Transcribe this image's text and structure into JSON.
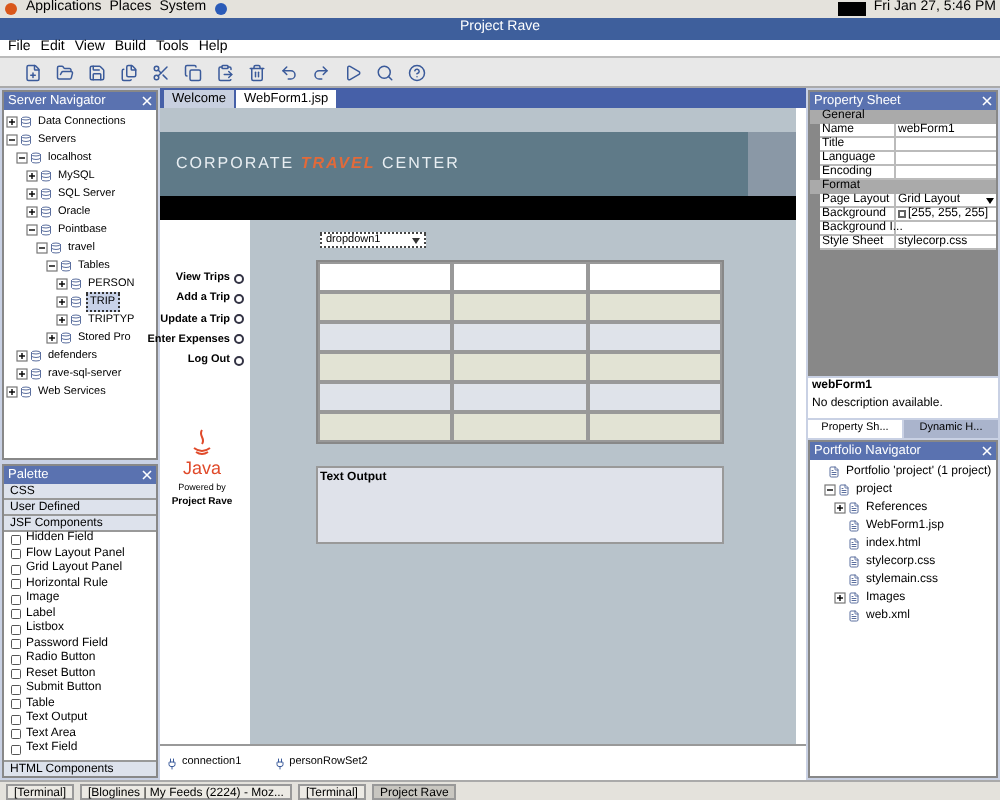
{
  "top_panel": {
    "menus": [
      "Applications",
      "Places",
      "System"
    ],
    "clock": "Fri Jan 27,  5:46 PM"
  },
  "window": {
    "title": "Project Rave"
  },
  "menu_bar": [
    "File",
    "Edit",
    "View",
    "Build",
    "Tools",
    "Help"
  ],
  "server_navigator": {
    "title": "Server Navigator",
    "tree": [
      {
        "label": "Data Connections",
        "expanded": false,
        "selected": false
      },
      {
        "label": "Servers",
        "expanded": true,
        "selected": false,
        "children": [
          {
            "label": "localhost",
            "expanded": true,
            "selected": false,
            "children": [
              {
                "label": "MySQL",
                "expanded": false,
                "selected": false
              },
              {
                "label": "SQL Server",
                "expanded": false,
                "selected": false
              },
              {
                "label": "Oracle",
                "expanded": false,
                "selected": false
              },
              {
                "label": "Pointbase",
                "expanded": true,
                "selected": false,
                "children": [
                  {
                    "label": "travel",
                    "expanded": true,
                    "selected": false,
                    "children": [
                      {
                        "label": "Tables",
                        "expanded": true,
                        "selected": false,
                        "children": [
                          {
                            "label": "PERSON",
                            "expanded": false,
                            "selected": false
                          },
                          {
                            "label": "TRIP",
                            "expanded": false,
                            "selected": true
                          },
                          {
                            "label": "TRIPTYP",
                            "expanded": false,
                            "selected": false
                          }
                        ]
                      },
                      {
                        "label": "Stored Pro",
                        "expanded": false,
                        "selected": false
                      }
                    ]
                  }
                ]
              }
            ]
          },
          {
            "label": "defenders",
            "expanded": false,
            "selected": false
          },
          {
            "label": "rave-sql-server",
            "expanded": false,
            "selected": false
          }
        ]
      },
      {
        "label": "Web Services",
        "expanded": false,
        "selected": false
      }
    ]
  },
  "palette": {
    "title": "Palette",
    "sections": [
      "CSS",
      "User Defined",
      "JSF Components"
    ],
    "items": [
      "Hidden Field",
      "Flow Layout Panel",
      "Grid Layout Panel",
      "Horizontal Rule",
      "Image",
      "Label",
      "Listbox",
      "Password Field",
      "Radio Button",
      "Reset Button",
      "Submit Button",
      "Table",
      "Text Output",
      "Text Area",
      "Text Field"
    ],
    "footer": "HTML Components"
  },
  "editor_tabs": [
    {
      "label": "Welcome",
      "selected": false
    },
    {
      "label": "WebForm1.jsp",
      "selected": true
    }
  ],
  "page": {
    "banner": {
      "left": "CORPORATE",
      "accent": "TRAVEL",
      "right": "CENTER"
    },
    "nav_links": [
      "View Trips",
      "Add a Trip",
      "Update a Trip",
      "Enter Expenses",
      "Log Out"
    ],
    "logo_text": "Java",
    "powered_by": "Powered by",
    "product": "Project Rave",
    "dropdown": "dropdown1",
    "text_output": "Text Output"
  },
  "nonvisual_tray": [
    "connection1",
    "personRowSet2"
  ],
  "property_sheet": {
    "title": "Property Sheet",
    "sections": [
      {
        "name": "General",
        "rows": [
          {
            "name": "Name",
            "value": "webForm1"
          },
          {
            "name": "Title"
          },
          {
            "name": "Language"
          },
          {
            "name": "Encoding"
          }
        ]
      },
      {
        "name": "Format",
        "rows": [
          {
            "name": "Page Layout",
            "value": "Grid Layout",
            "kind": "dropdown"
          },
          {
            "name": "Background",
            "value": "[255, 255, 255]",
            "kind": "color"
          },
          {
            "name": "Background I..."
          },
          {
            "name": "Style Sheet",
            "value": "stylecorp.css"
          }
        ]
      }
    ],
    "description_title": "webForm1",
    "description": "No description available.",
    "tabs": [
      {
        "label": "Property Sh...",
        "selected": true
      },
      {
        "label": "Dynamic H...",
        "selected": false
      }
    ]
  },
  "portfolio_navigator": {
    "title": "Portfolio Navigator",
    "tree": [
      {
        "label": "Portfolio 'project' (1 project)",
        "children": [
          {
            "label": "project",
            "expanded": true,
            "children": [
              {
                "label": "References",
                "expanded": false
              },
              {
                "label": "WebForm1.jsp"
              },
              {
                "label": "index.html"
              },
              {
                "label": "stylecorp.css"
              },
              {
                "label": "stylemain.css"
              },
              {
                "label": "Images",
                "expanded": false
              },
              {
                "label": "web.xml"
              }
            ]
          }
        ]
      }
    ]
  },
  "taskbar": [
    {
      "label": "[Terminal]",
      "selected": false
    },
    {
      "label": "[Bloglines | My Feeds (2224) - Moz...",
      "selected": false
    },
    {
      "label": "[Terminal]",
      "selected": false
    },
    {
      "label": "Project Rave",
      "selected": true
    }
  ]
}
